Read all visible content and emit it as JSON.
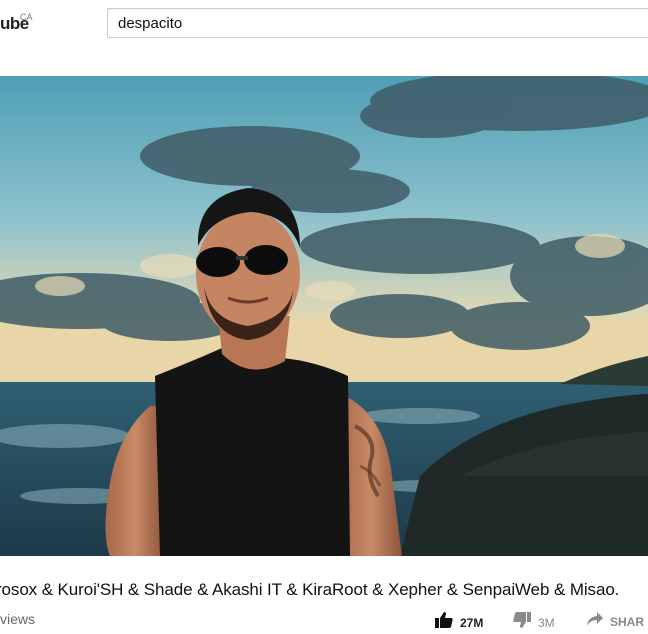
{
  "header": {
    "logo_text": "ube",
    "logo_region": "CA",
    "search_value": "despacito"
  },
  "video": {
    "title": "rosox & Kuroi'SH & Shade & Akashi IT & KiraRoot & Xepher & SenpaiWeb & Misao.",
    "views_label": "views",
    "like_count": "27M",
    "dislike_count": "3M",
    "share_label": "SHAR"
  }
}
